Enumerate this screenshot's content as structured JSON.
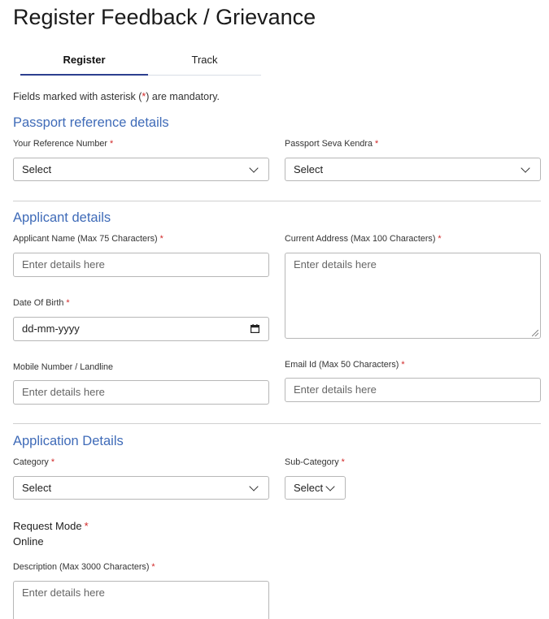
{
  "page": {
    "title": "Register Feedback / Grievance"
  },
  "tabs": {
    "register": "Register",
    "track": "Track"
  },
  "note": {
    "prefix": "Fields marked with asterisk (",
    "star": "*",
    "suffix": ") are mandatory."
  },
  "sections": {
    "passport": "Passport reference details",
    "applicant": "Applicant details",
    "application": "Application Details"
  },
  "required_mark": "*",
  "passport": {
    "reference_label": "Your Reference Number",
    "reference_value": "Select",
    "psk_label": "Passport Seva Kendra",
    "psk_value": "Select"
  },
  "applicant": {
    "name_label": "Applicant Name (Max 75 Characters)",
    "name_placeholder": "Enter details here",
    "address_label": "Current Address (Max 100 Characters)",
    "address_placeholder": "Enter details here",
    "dob_label": "Date Of Birth",
    "dob_placeholder": "dd-mm-yyyy",
    "mobile_label": "Mobile Number / Landline",
    "mobile_placeholder": "Enter details here",
    "email_label": "Email Id (Max 50 Characters)",
    "email_placeholder": "Enter details here"
  },
  "application": {
    "category_label": "Category",
    "category_value": "Select",
    "subcategory_label": "Sub-Category",
    "subcategory_value": "Select",
    "request_mode_label": "Request Mode",
    "request_mode_value": "Online",
    "description_label": "Description (Max 3000 Characters)",
    "description_placeholder": "Enter details here"
  },
  "colors": {
    "section_title": "#3f6bb8",
    "required": "#d12727",
    "tab_active_underline": "#2c3f8f"
  },
  "icons": {
    "dropdown": "chevron-down-icon",
    "calendar": "calendar-icon",
    "resize": "resize-grip-icon"
  }
}
